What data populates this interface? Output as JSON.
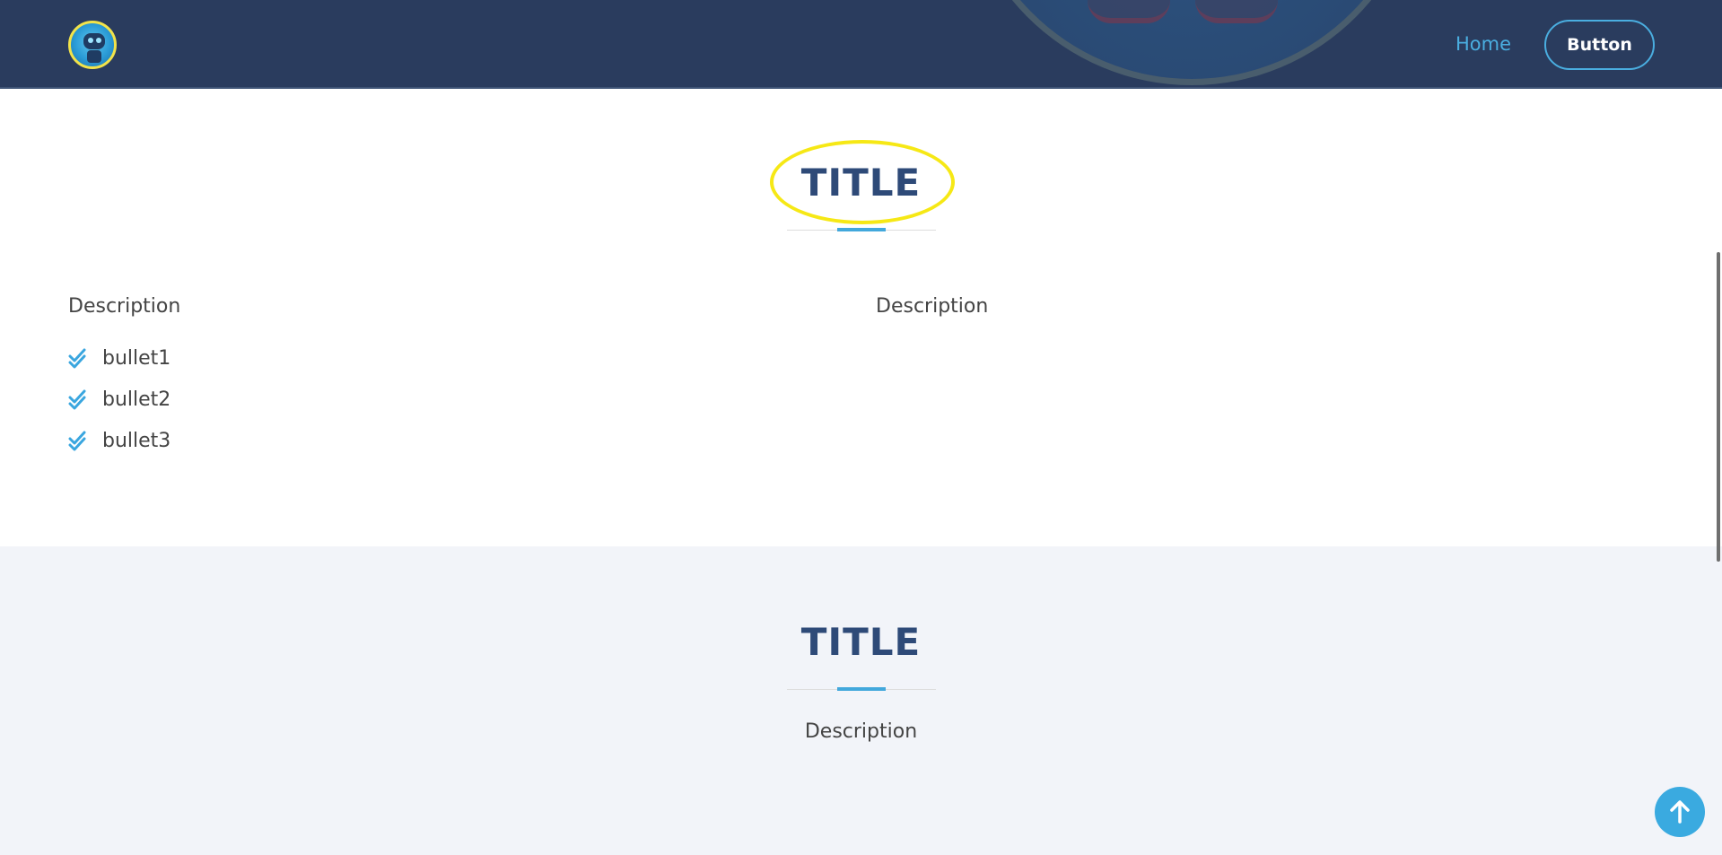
{
  "colors": {
    "header_bg": "#2a3c5e",
    "accent": "#42a8dc",
    "title": "#2e4a78",
    "highlight": "#f6e815",
    "section_alt_bg": "#f2f4f9"
  },
  "header": {
    "logo_icon": "robot-logo-icon",
    "nav_home": "Home",
    "nav_button": "Button"
  },
  "section1": {
    "title": "TITLE",
    "left_description": "Description",
    "right_description": "Description",
    "bullets": [
      {
        "icon": "double-check-icon",
        "label": "bullet1"
      },
      {
        "icon": "double-check-icon",
        "label": "bullet2"
      },
      {
        "icon": "double-check-icon",
        "label": "bullet3"
      }
    ]
  },
  "section2": {
    "title": "TITLE",
    "description": "Description"
  },
  "scroll_top": {
    "icon": "arrow-up-icon"
  }
}
